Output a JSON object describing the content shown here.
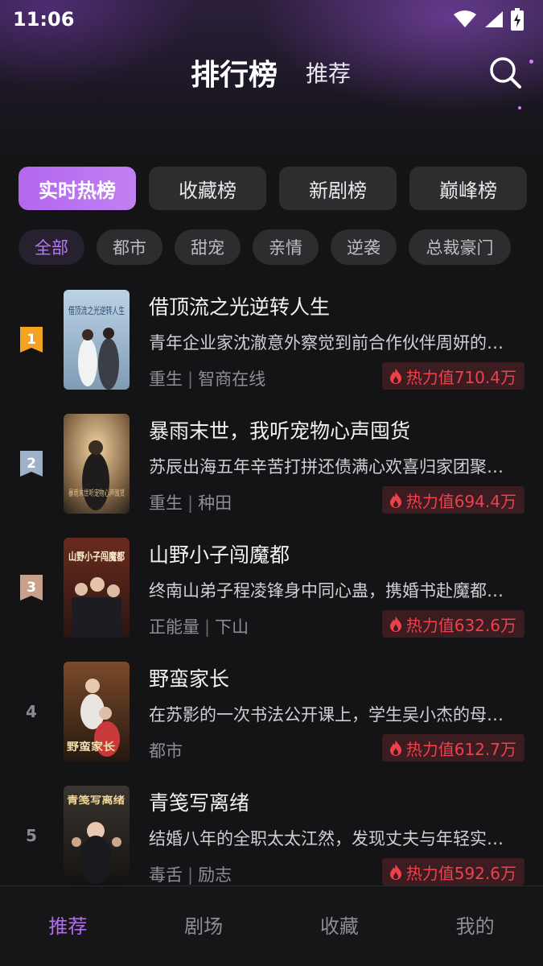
{
  "status_bar": {
    "time": "11:06"
  },
  "header": {
    "title": "排行榜",
    "subtitle": "推荐"
  },
  "ranking_tabs": [
    {
      "label": "实时热榜",
      "active": true
    },
    {
      "label": "收藏榜",
      "active": false
    },
    {
      "label": "新剧榜",
      "active": false
    },
    {
      "label": "巅峰榜",
      "active": false
    }
  ],
  "genre_filters": [
    {
      "label": "全部",
      "active": true
    },
    {
      "label": "都市",
      "active": false
    },
    {
      "label": "甜宠",
      "active": false
    },
    {
      "label": "亲情",
      "active": false
    },
    {
      "label": "逆袭",
      "active": false
    },
    {
      "label": "总裁豪门",
      "active": false
    }
  ],
  "items": [
    {
      "rank": "1",
      "title": "借顶流之光逆转人生",
      "desc": "青年企业家沈澈意外察觉到前合作伙伴周妍的…",
      "tag1": "重生",
      "tag2": "智商在线",
      "heat": "热力值710.4万",
      "cover_text": "借顶流之光逆转人生"
    },
    {
      "rank": "2",
      "title": "暴雨末世，我听宠物心声囤货",
      "desc": "苏辰出海五年辛苦打拼还债满心欢喜归家团聚…",
      "tag1": "重生",
      "tag2": "种田",
      "heat": "热力值694.4万",
      "cover_text": "暴雨末世听宠物心声囤货"
    },
    {
      "rank": "3",
      "title": "山野小子闯魔都",
      "desc": "终南山弟子程凌锋身中同心蛊，携婚书赴魔都…",
      "tag1": "正能量",
      "tag2": "下山",
      "heat": "热力值632.6万",
      "cover_text": "山野小子闯魔都"
    },
    {
      "rank": "4",
      "title": "野蛮家长",
      "desc": "在苏影的一次书法公开课上，学生吴小杰的母…",
      "tag1": "都市",
      "tag2": "",
      "heat": "热力值612.7万",
      "cover_text": "野蛮家长"
    },
    {
      "rank": "5",
      "title": "青笺写离绪",
      "desc": "结婚八年的全职太太江然，发现丈夫与年轻实…",
      "tag1": "毒舌",
      "tag2": "励志",
      "heat": "热力值592.6万",
      "cover_text": "青笺写离绪"
    }
  ],
  "bottom_nav": [
    {
      "label": "推荐",
      "active": true
    },
    {
      "label": "剧场",
      "active": false
    },
    {
      "label": "收藏",
      "active": false
    },
    {
      "label": "我的",
      "active": false
    }
  ],
  "colors": {
    "accent": "#b36cf0",
    "heat": "#f0404a",
    "rank1": "#f3a321",
    "rank2": "#9fb0c9",
    "rank3": "#c9a08a"
  }
}
